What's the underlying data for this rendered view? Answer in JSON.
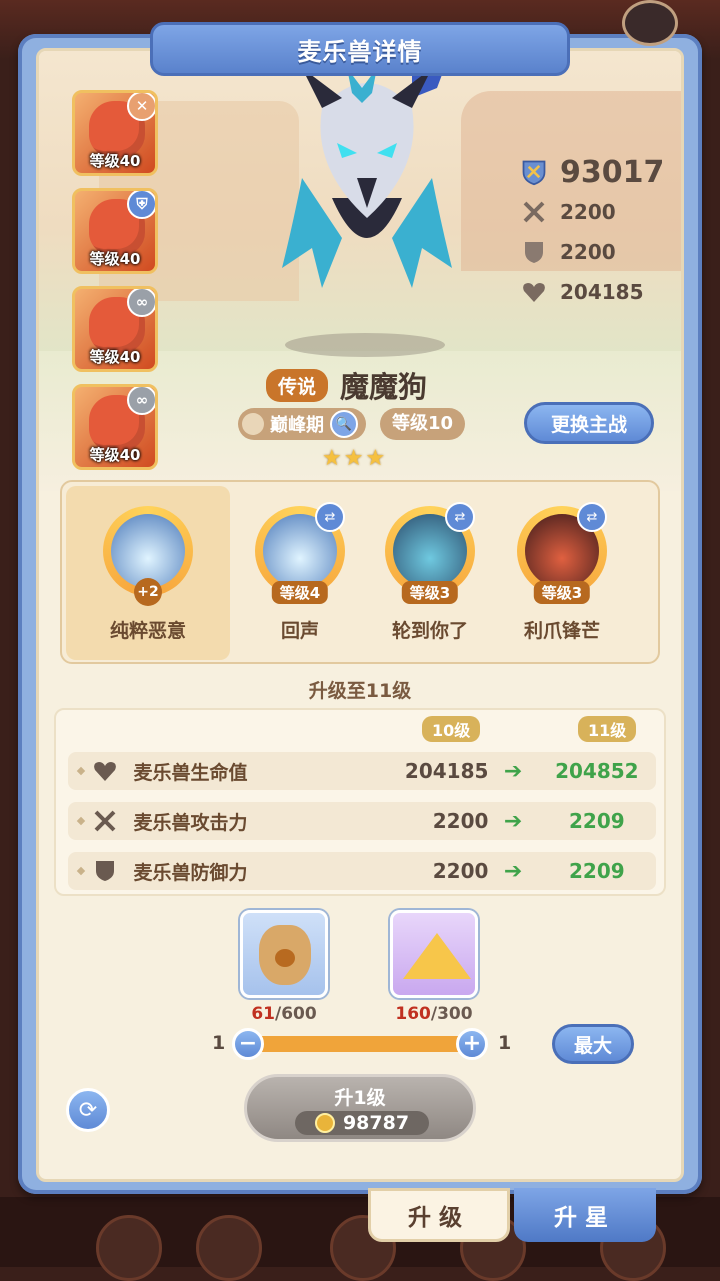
{
  "title": "麦乐兽详情",
  "team": [
    {
      "level": "等级40",
      "badge": "close",
      "badge_color": "#e8a070"
    },
    {
      "level": "等级40",
      "badge": "shield",
      "badge_color": "#5f8ad6"
    },
    {
      "level": "等级40",
      "badge": "link",
      "badge_color": "#9aa0a8"
    },
    {
      "level": "等级40",
      "badge": "link",
      "badge_color": "#9aa0a8"
    }
  ],
  "stats": {
    "power": "93017",
    "attack": "2200",
    "defense": "2200",
    "hp": "204185"
  },
  "pet": {
    "rarity": "传说",
    "name": "魔魔狗",
    "stage": "巅峰期",
    "level": "等级10",
    "stars": "★★★",
    "switch_label": "更换主战"
  },
  "skills": [
    {
      "name": "纯粹恶意",
      "badge": "+2"
    },
    {
      "name": "回声",
      "level": "等级4"
    },
    {
      "name": "轮到你了",
      "level": "等级3"
    },
    {
      "name": "利爪锋芒",
      "level": "等级3"
    }
  ],
  "upgrade": {
    "title": "升级至11级",
    "from_level": "10级",
    "to_level": "11级",
    "rows": [
      {
        "label": "麦乐兽生命值",
        "from": "204185",
        "to": "204852",
        "icon": "heart-icon"
      },
      {
        "label": "麦乐兽攻击力",
        "from": "2200",
        "to": "2209",
        "icon": "swords-icon"
      },
      {
        "label": "麦乐兽防御力",
        "from": "2200",
        "to": "2209",
        "icon": "shield-icon"
      }
    ],
    "arrow": "➔"
  },
  "materials": [
    {
      "have": "61",
      "need": "/600",
      "icon": "food-bag-icon"
    },
    {
      "have": "160",
      "need": "/300",
      "icon": "cheese-icon"
    }
  ],
  "slider": {
    "min": "1",
    "max": "1",
    "minus": "−",
    "plus": "+",
    "max_label": "最大",
    "fill": 1.0
  },
  "level_button": {
    "label": "升1级",
    "cost": "98787"
  },
  "tabs": {
    "active": "升级",
    "inactive": "升星"
  },
  "colors": {
    "accent_blue": "#5f8ad6",
    "orange": "#f0a43a",
    "green": "#3fa34a",
    "rarity": "#c9752a"
  }
}
